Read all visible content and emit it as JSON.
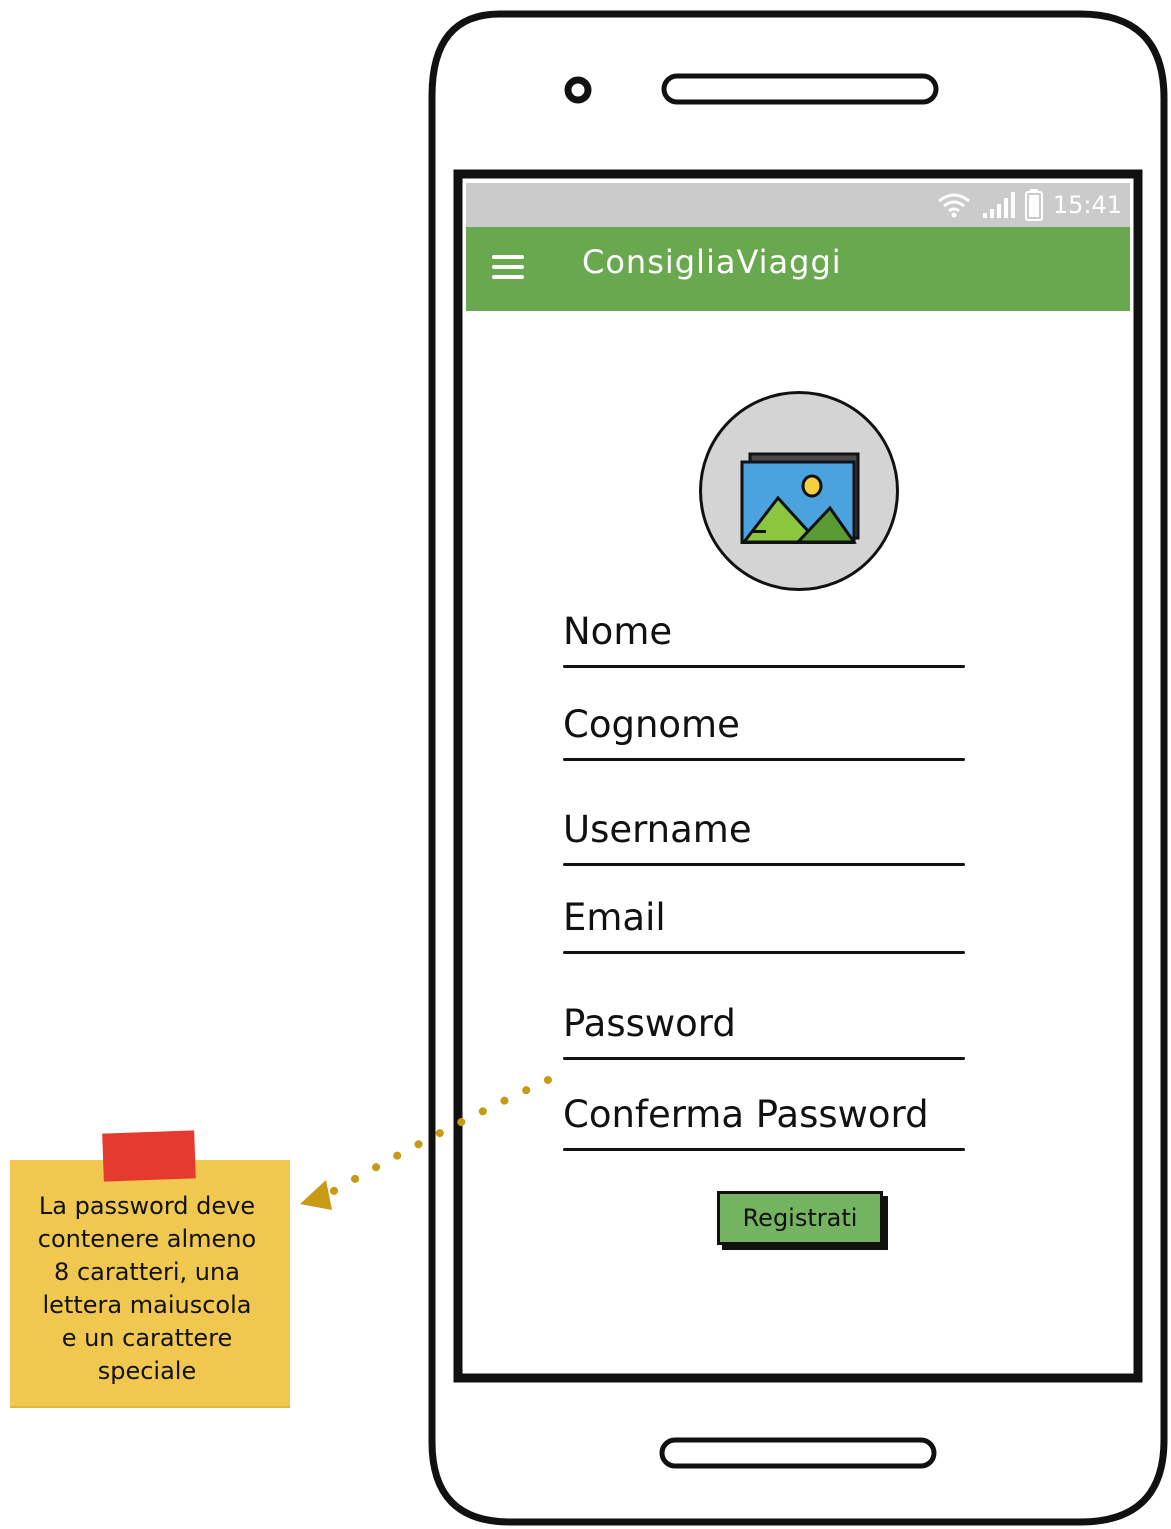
{
  "status_bar": {
    "time": "15:41",
    "icons": [
      "wifi-icon",
      "signal-icon",
      "battery-icon"
    ]
  },
  "app_bar": {
    "title": "ConsigliaViaggi",
    "menu_icon": "hamburger-menu-icon"
  },
  "avatar": {
    "icon": "image-placeholder-icon"
  },
  "form": {
    "fields": [
      {
        "label": "Nome"
      },
      {
        "label": "Cognome"
      },
      {
        "label": "Username"
      },
      {
        "label": "Email"
      },
      {
        "label": "Password"
      },
      {
        "label": "Conferma Password"
      }
    ],
    "submit_label": "Registrati"
  },
  "annotation": {
    "note_lines": [
      "La password deve",
      "contenere almeno",
      "8 caratteri, una",
      "lettera maiuscola",
      "e un carattere",
      "speciale"
    ]
  },
  "colors": {
    "app_bar": "#6aa84f",
    "status_bar": "#cbcbcb",
    "button": "#74b35f",
    "sticky_note": "#f1c84f",
    "sticky_tape": "#e53b2f",
    "arrow": "#c99a14"
  }
}
